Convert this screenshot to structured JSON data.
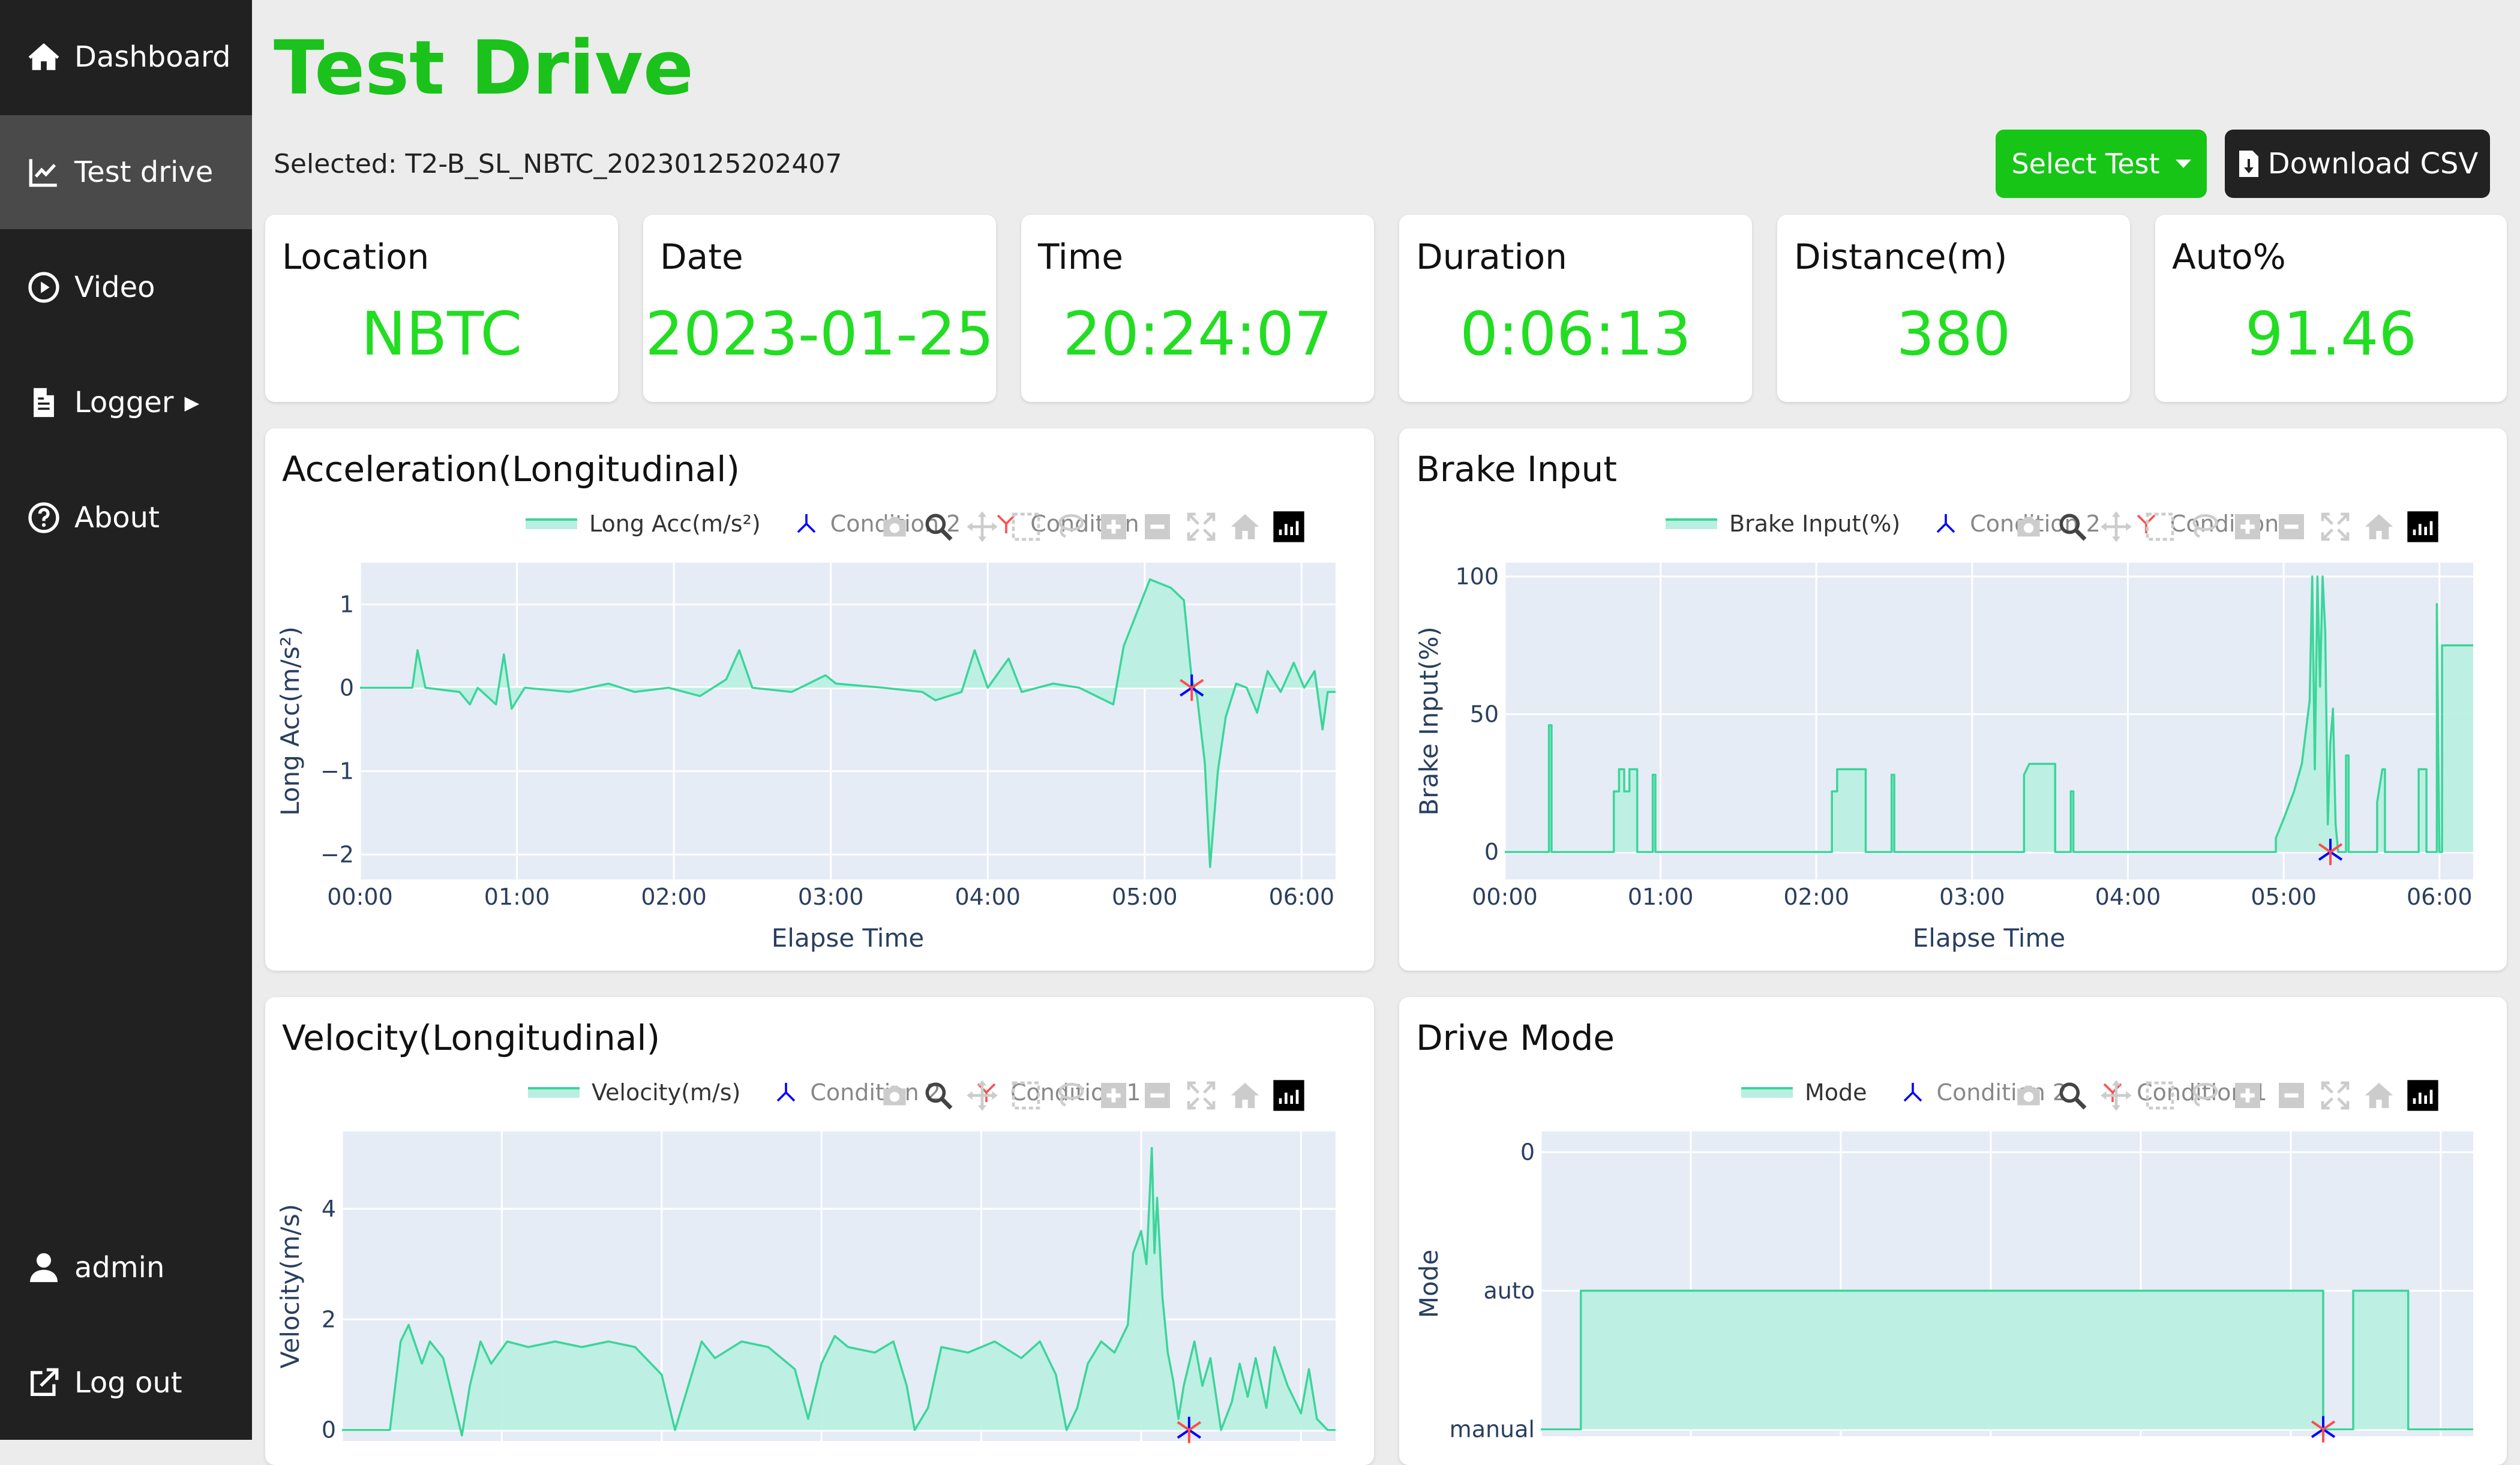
{
  "sidebar": {
    "items": [
      {
        "label": "Dashboard",
        "icon": "home-icon"
      },
      {
        "label": "Test drive",
        "icon": "chart-line-icon",
        "active": true
      },
      {
        "label": "Video",
        "icon": "play-circle-icon"
      },
      {
        "label": "Logger",
        "icon": "file-icon",
        "has_caret": true
      },
      {
        "label": "About",
        "icon": "question-circle-icon"
      }
    ],
    "user": {
      "label": "admin",
      "icon": "user-icon"
    },
    "logout": {
      "label": "Log out",
      "icon": "logout-icon"
    }
  },
  "header": {
    "title": "Test Drive",
    "selected_text": "Selected: T2-B_SL_NBTC_20230125202407",
    "select_button": "Select Test",
    "download_button": "Download CSV"
  },
  "stats": [
    {
      "title": "Location",
      "value": "NBTC"
    },
    {
      "title": "Date",
      "value": "2023-01-25"
    },
    {
      "title": "Time",
      "value": "20:24:07"
    },
    {
      "title": "Duration",
      "value": "0:06:13"
    },
    {
      "title": "Distance(m)",
      "value": "380"
    },
    {
      "title": "Auto%",
      "value": "91.46"
    }
  ],
  "colors": {
    "accent": "#1bc21b",
    "value_green": "#22dd22",
    "sidebar_bg": "#212121",
    "trace_line": "#3bd59a",
    "trace_fill": "#b8efe0",
    "plot_bg": "#e5ecf6",
    "condition_1": "#ff4d4d",
    "condition_2": "#0000ff"
  },
  "chart_data": [
    {
      "id": "accel",
      "title": "Acceleration(Longitudinal)",
      "type": "area",
      "series": [
        {
          "name": "Long Acc(m/s²)"
        }
      ],
      "conditions": [
        {
          "name": "Condition 2",
          "x": 318,
          "y": 0
        },
        {
          "name": "Condition 1",
          "x": 318,
          "y": 0
        }
      ],
      "xlabel": "Elapse Time",
      "ylabel": "Long Acc(m/s²)",
      "xticks": [
        "00:00",
        "01:00",
        "02:00",
        "03:00",
        "04:00",
        "05:00",
        "06:00"
      ],
      "yticks": [
        "1",
        "0",
        "−1",
        "−2"
      ],
      "xlim": [
        0,
        373
      ],
      "ylim": [
        -2.3,
        1.5
      ],
      "ytick_values": [
        1,
        0,
        -1,
        -2
      ],
      "baseline": 0,
      "points": [
        [
          0,
          0
        ],
        [
          20,
          0
        ],
        [
          22,
          0.45
        ],
        [
          25,
          0
        ],
        [
          38,
          -0.05
        ],
        [
          42,
          -0.2
        ],
        [
          45,
          0
        ],
        [
          52,
          -0.2
        ],
        [
          55,
          0.4
        ],
        [
          58,
          -0.25
        ],
        [
          63,
          0
        ],
        [
          80,
          -0.05
        ],
        [
          95,
          0.05
        ],
        [
          105,
          -0.05
        ],
        [
          118,
          0
        ],
        [
          130,
          -0.1
        ],
        [
          140,
          0.1
        ],
        [
          145,
          0.45
        ],
        [
          150,
          0
        ],
        [
          165,
          -0.05
        ],
        [
          178,
          0.15
        ],
        [
          182,
          0.05
        ],
        [
          200,
          0
        ],
        [
          215,
          -0.05
        ],
        [
          220,
          -0.15
        ],
        [
          230,
          -0.05
        ],
        [
          235,
          0.45
        ],
        [
          240,
          0
        ],
        [
          248,
          0.35
        ],
        [
          253,
          -0.05
        ],
        [
          265,
          0.05
        ],
        [
          275,
          0
        ],
        [
          288,
          -0.2
        ],
        [
          292,
          0.5
        ],
        [
          297,
          0.9
        ],
        [
          302,
          1.3
        ],
        [
          310,
          1.2
        ],
        [
          315,
          1.05
        ],
        [
          318,
          0.1
        ],
        [
          320,
          -0.1
        ],
        [
          323,
          -0.9
        ],
        [
          325,
          -2.15
        ],
        [
          328,
          -1.0
        ],
        [
          331,
          -0.35
        ],
        [
          335,
          0.05
        ],
        [
          339,
          0
        ],
        [
          343,
          -0.3
        ],
        [
          347,
          0.2
        ],
        [
          352,
          -0.05
        ],
        [
          357,
          0.3
        ],
        [
          361,
          0
        ],
        [
          365,
          0.2
        ],
        [
          368,
          -0.5
        ],
        [
          370,
          -0.05
        ],
        [
          373,
          -0.05
        ]
      ]
    },
    {
      "id": "brake",
      "title": "Brake Input",
      "type": "area",
      "series": [
        {
          "name": "Brake Input(%)"
        }
      ],
      "conditions": [
        {
          "name": "Condition 2",
          "x": 318,
          "y": 0
        },
        {
          "name": "Condition 1",
          "x": 318,
          "y": 0
        }
      ],
      "xlabel": "Elapse Time",
      "ylabel": "Brake Input(%)",
      "xticks": [
        "00:00",
        "01:00",
        "02:00",
        "03:00",
        "04:00",
        "05:00",
        "06:00"
      ],
      "yticks": [
        "100",
        "50",
        "0"
      ],
      "xlim": [
        0,
        373
      ],
      "ylim": [
        -10,
        105
      ],
      "ytick_values": [
        100,
        50,
        0
      ],
      "baseline": 0,
      "points": [
        [
          0,
          0
        ],
        [
          17,
          0
        ],
        [
          17,
          46
        ],
        [
          18,
          46
        ],
        [
          18,
          0
        ],
        [
          42,
          0
        ],
        [
          42,
          22
        ],
        [
          44,
          22
        ],
        [
          44,
          30
        ],
        [
          46,
          30
        ],
        [
          46,
          22
        ],
        [
          48,
          22
        ],
        [
          48,
          30
        ],
        [
          51,
          30
        ],
        [
          51,
          0
        ],
        [
          57,
          0
        ],
        [
          57,
          28
        ],
        [
          58,
          28
        ],
        [
          58,
          0
        ],
        [
          126,
          0
        ],
        [
          126,
          22
        ],
        [
          128,
          22
        ],
        [
          128,
          30
        ],
        [
          139,
          30
        ],
        [
          139,
          0
        ],
        [
          149,
          0
        ],
        [
          149,
          28
        ],
        [
          150,
          28
        ],
        [
          150,
          0
        ],
        [
          200,
          0
        ],
        [
          200,
          28
        ],
        [
          202,
          32
        ],
        [
          212,
          32
        ],
        [
          212,
          0
        ],
        [
          218,
          0
        ],
        [
          218,
          22
        ],
        [
          219,
          22
        ],
        [
          219,
          0
        ],
        [
          297,
          0
        ],
        [
          297,
          5
        ],
        [
          300,
          12
        ],
        [
          304,
          22
        ],
        [
          307,
          32
        ],
        [
          310,
          55
        ],
        [
          311,
          100
        ],
        [
          312,
          30
        ],
        [
          313,
          100
        ],
        [
          314,
          60
        ],
        [
          315,
          100
        ],
        [
          316,
          80
        ],
        [
          317,
          10
        ],
        [
          318,
          40
        ],
        [
          319,
          52
        ],
        [
          320,
          10
        ],
        [
          321,
          0
        ],
        [
          324,
          0
        ],
        [
          324,
          35
        ],
        [
          325,
          35
        ],
        [
          325,
          0
        ],
        [
          336,
          0
        ],
        [
          336,
          18
        ],
        [
          338,
          30
        ],
        [
          339,
          30
        ],
        [
          339,
          0
        ],
        [
          352,
          0
        ],
        [
          352,
          30
        ],
        [
          355,
          30
        ],
        [
          355,
          0
        ],
        [
          359,
          0
        ],
        [
          359,
          90
        ],
        [
          360,
          0
        ],
        [
          361,
          0
        ],
        [
          361,
          75
        ],
        [
          373,
          75
        ]
      ]
    },
    {
      "id": "velocity",
      "title": "Velocity(Longitudinal)",
      "type": "area",
      "series": [
        {
          "name": "Velocity(m/s)"
        }
      ],
      "conditions": [
        {
          "name": "Condition 2",
          "x": 318,
          "y": 0
        },
        {
          "name": "Condition 1",
          "x": 318,
          "y": 0
        }
      ],
      "xlabel": "",
      "ylabel": "Velocity(m/s)",
      "xticks": [],
      "yticks": [
        "4",
        "2",
        "0"
      ],
      "xlim": [
        0,
        373
      ],
      "ylim": [
        -0.2,
        5.4
      ],
      "ytick_values": [
        4,
        2,
        0
      ],
      "baseline": 0,
      "points": [
        [
          0,
          0
        ],
        [
          18,
          0
        ],
        [
          22,
          1.6
        ],
        [
          25,
          1.9
        ],
        [
          30,
          1.2
        ],
        [
          33,
          1.6
        ],
        [
          38,
          1.3
        ],
        [
          42,
          0.5
        ],
        [
          45,
          -0.1
        ],
        [
          48,
          0.8
        ],
        [
          52,
          1.6
        ],
        [
          56,
          1.2
        ],
        [
          62,
          1.6
        ],
        [
          70,
          1.5
        ],
        [
          80,
          1.6
        ],
        [
          90,
          1.5
        ],
        [
          100,
          1.6
        ],
        [
          110,
          1.5
        ],
        [
          120,
          1.0
        ],
        [
          125,
          0
        ],
        [
          130,
          0.8
        ],
        [
          135,
          1.6
        ],
        [
          140,
          1.3
        ],
        [
          150,
          1.6
        ],
        [
          160,
          1.5
        ],
        [
          170,
          1.1
        ],
        [
          175,
          0.2
        ],
        [
          180,
          1.2
        ],
        [
          185,
          1.7
        ],
        [
          190,
          1.5
        ],
        [
          200,
          1.4
        ],
        [
          207,
          1.6
        ],
        [
          212,
          0.8
        ],
        [
          215,
          0
        ],
        [
          220,
          0.4
        ],
        [
          225,
          1.5
        ],
        [
          235,
          1.4
        ],
        [
          245,
          1.6
        ],
        [
          255,
          1.3
        ],
        [
          262,
          1.6
        ],
        [
          268,
          1.0
        ],
        [
          272,
          0
        ],
        [
          276,
          0.4
        ],
        [
          280,
          1.2
        ],
        [
          285,
          1.6
        ],
        [
          290,
          1.4
        ],
        [
          295,
          1.9
        ],
        [
          297,
          3.2
        ],
        [
          300,
          3.6
        ],
        [
          302,
          3.0
        ],
        [
          304,
          5.1
        ],
        [
          305,
          3.2
        ],
        [
          306,
          4.2
        ],
        [
          308,
          2.4
        ],
        [
          310,
          1.4
        ],
        [
          312,
          0.9
        ],
        [
          314,
          0.2
        ],
        [
          316,
          0.8
        ],
        [
          320,
          1.6
        ],
        [
          323,
          0.8
        ],
        [
          326,
          1.3
        ],
        [
          330,
          0
        ],
        [
          334,
          0.5
        ],
        [
          337,
          1.2
        ],
        [
          340,
          0.6
        ],
        [
          343,
          1.3
        ],
        [
          347,
          0.4
        ],
        [
          350,
          1.5
        ],
        [
          355,
          0.8
        ],
        [
          360,
          0.3
        ],
        [
          363,
          1.1
        ],
        [
          366,
          0.2
        ],
        [
          370,
          0
        ],
        [
          373,
          0
        ]
      ]
    },
    {
      "id": "mode",
      "title": "Drive Mode",
      "type": "area",
      "series": [
        {
          "name": "Mode"
        }
      ],
      "conditions": [
        {
          "name": "Condition 2",
          "x": 313,
          "y": 0
        },
        {
          "name": "Condition 1",
          "x": 313,
          "y": 0
        }
      ],
      "xlabel": "",
      "ylabel": "Mode",
      "xticks": [],
      "yticks": [
        "0",
        "auto",
        "manual"
      ],
      "xlim": [
        0,
        373
      ],
      "ylim": [
        -0.05,
        2.15
      ],
      "ytick_values": [
        2,
        1,
        0
      ],
      "baseline": 0,
      "points": [
        [
          0,
          0
        ],
        [
          16,
          0
        ],
        [
          16,
          1
        ],
        [
          313,
          1
        ],
        [
          313,
          0
        ],
        [
          325,
          0
        ],
        [
          325,
          1
        ],
        [
          347,
          1
        ],
        [
          347,
          0
        ],
        [
          373,
          0
        ]
      ]
    }
  ]
}
